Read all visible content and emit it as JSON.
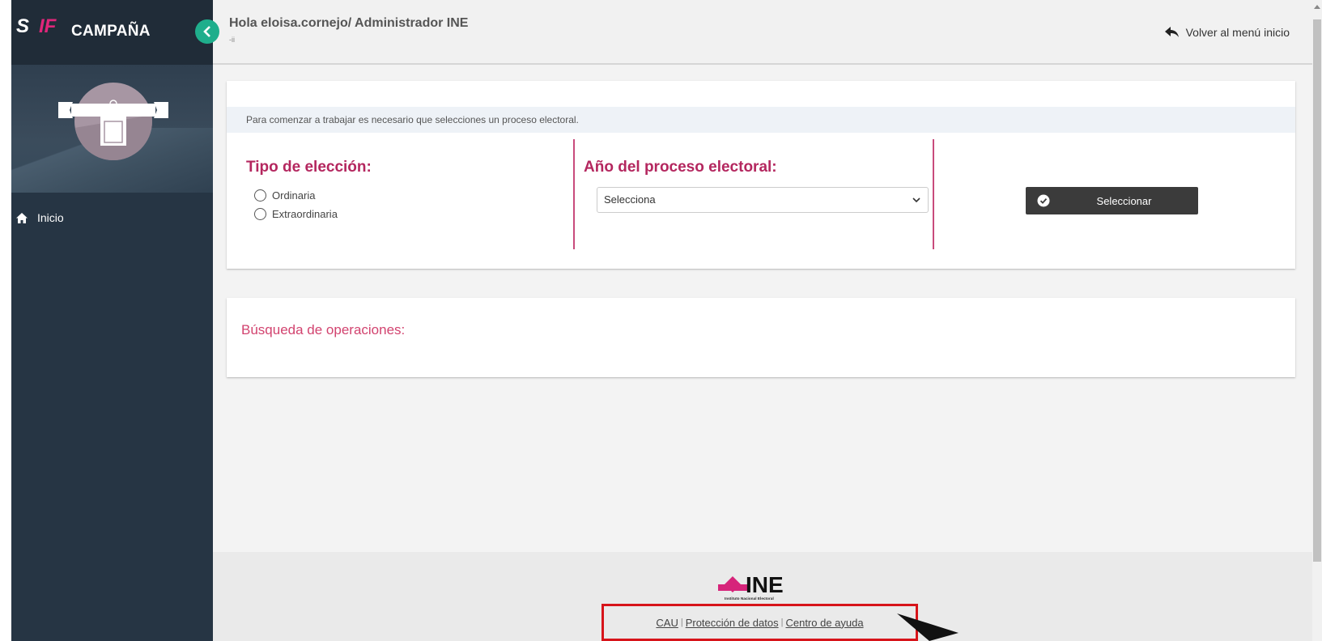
{
  "app": {
    "brand_title": "CAMPAÑA",
    "logo_s": "S",
    "logo_if": "IF"
  },
  "sidebar": {
    "items": [
      {
        "label": "Inicio",
        "icon": "home-icon"
      }
    ]
  },
  "header": {
    "greeting": "Hola eloisa.cornejo/ Administrador INE",
    "subtext": "-ii",
    "back_link": "Volver al menú inicio"
  },
  "process_card": {
    "notice": "Para comenzar a trabajar es necesario que selecciones un proceso electoral.",
    "election_type_title": "Tipo de elección:",
    "options": [
      "Ordinaria",
      "Extraordinaria"
    ],
    "year_title": "Año del proceso electoral:",
    "year_select_value": "Selecciona",
    "select_button": "Seleccionar"
  },
  "search_card": {
    "title": "Búsqueda de operaciones:"
  },
  "footer": {
    "logo_text": "INE",
    "logo_subtitle": "Instituto Nacional Electoral",
    "links": [
      "CAU",
      "Protección de datos",
      "Centro de ayuda"
    ],
    "separator": "|"
  },
  "colors": {
    "sidebar_bg": "#263544",
    "brand_bg": "#202c38",
    "accent_pink": "#b4275f",
    "toggle_green": "#1fae8c",
    "highlight_red": "#d7141a"
  }
}
